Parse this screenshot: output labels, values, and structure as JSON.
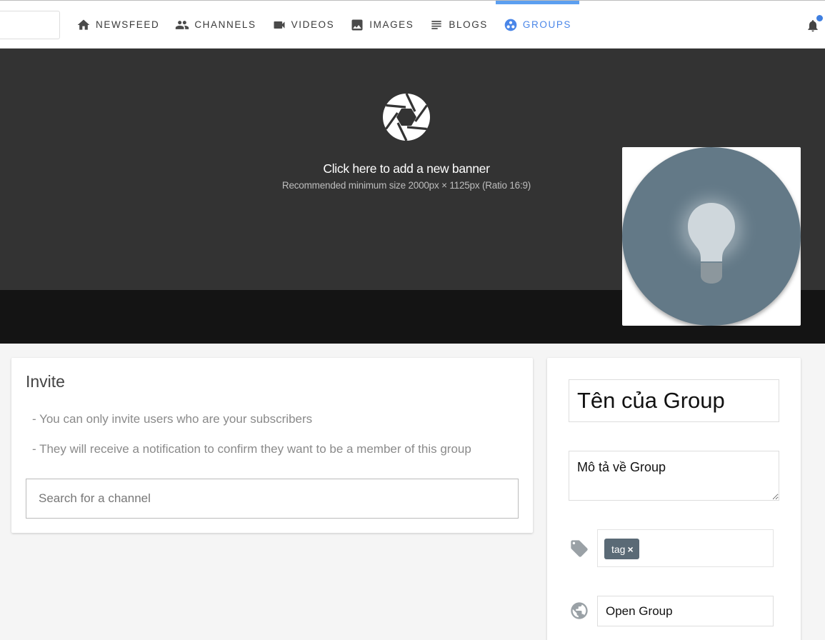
{
  "nav": {
    "items": [
      {
        "label": "NEWSFEED",
        "icon": "home-icon"
      },
      {
        "label": "CHANNELS",
        "icon": "people-icon"
      },
      {
        "label": "VIDEOS",
        "icon": "videocam-icon"
      },
      {
        "label": "IMAGES",
        "icon": "image-icon"
      },
      {
        "label": "BLOGS",
        "icon": "lines-icon"
      },
      {
        "label": "GROUPS",
        "icon": "group-work-icon",
        "active": true
      }
    ],
    "active_color": "#4a86e8"
  },
  "banner": {
    "title": "Click here to add a new banner",
    "subtitle": "Recommended minimum size 2000px × 1125px (Ratio 16:9)",
    "icon": "camera-shutter-icon"
  },
  "avatar": {
    "icon": "lightbulb-icon",
    "color": "#637987"
  },
  "invite": {
    "title": "Invite",
    "rules": [
      "- You can only invite users who are your subscribers",
      "- They will receive a notification to confirm they want to be a member of this group"
    ],
    "search_placeholder": "Search for a channel"
  },
  "group": {
    "name_placeholder": "Tên của Group",
    "description_placeholder": "Mô tả về Group",
    "tags": [
      {
        "label": "tag",
        "remove": "×"
      }
    ],
    "privacy": "Open Group"
  }
}
